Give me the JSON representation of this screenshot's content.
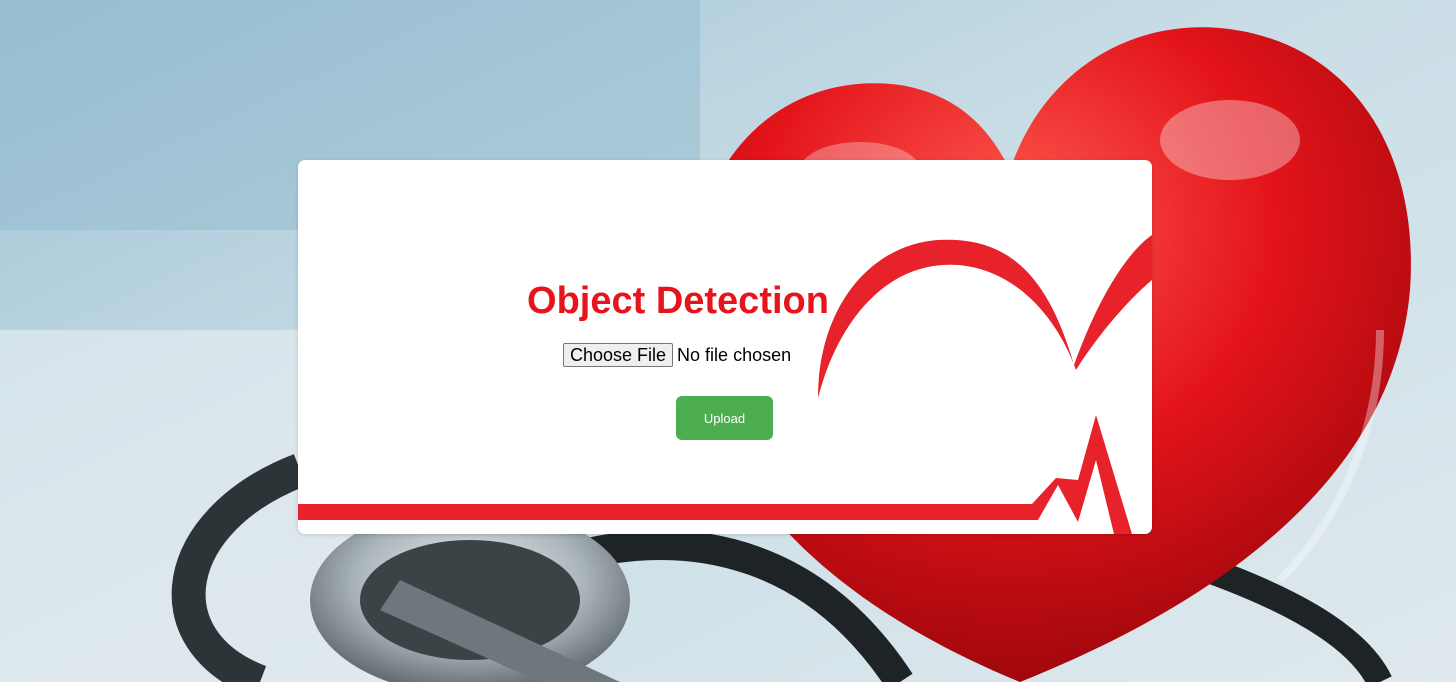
{
  "app": {
    "title": "Object Detection"
  },
  "file_input": {
    "button_label": "Choose File",
    "status": "No file chosen"
  },
  "upload": {
    "label": "Upload"
  },
  "colors": {
    "accent_red": "#e8141b",
    "upload_green": "#4cae4f",
    "card_bg": "#ffffff"
  },
  "icons": [
    "heart-graphic",
    "heartbeat-line"
  ]
}
